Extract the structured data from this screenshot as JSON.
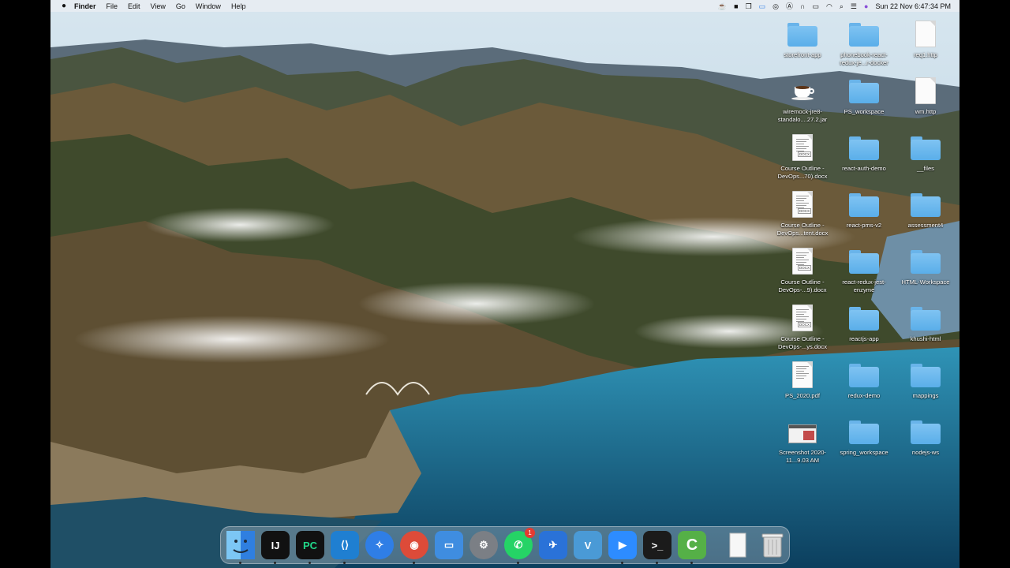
{
  "menubar": {
    "app_name": "Finder",
    "menus": [
      "File",
      "Edit",
      "View",
      "Go",
      "Window",
      "Help"
    ],
    "tray_icons": [
      "coffee-cup-icon",
      "k-icon",
      "copy-icon",
      "window-icon",
      "podcast-icon",
      "a-icon",
      "headphones-icon",
      "battery-icon",
      "wifi-icon",
      "search-icon",
      "control-center-icon",
      "siri-icon"
    ],
    "clock": "Sun 22 Nov  6:47:34 PM"
  },
  "desktop": {
    "items": [
      {
        "label": "storefront-app",
        "type": "folder",
        "col": 0,
        "row": 0
      },
      {
        "label": "phonebook-react-redux-je...r-docker",
        "type": "folder",
        "col": 1,
        "row": 0
      },
      {
        "label": "req1.http",
        "type": "document",
        "col": 2,
        "row": 0
      },
      {
        "label": "wiremock-jre8-standalo....27.2.jar",
        "type": "jar",
        "col": 0,
        "row": 1
      },
      {
        "label": "PS_workspace",
        "type": "folder",
        "col": 1,
        "row": 1
      },
      {
        "label": "wm.http",
        "type": "document",
        "col": 2,
        "row": 1
      },
      {
        "label": "Course Outline - DevOps...70).docx",
        "type": "docx",
        "col": 0,
        "row": 2
      },
      {
        "label": "react-auth-demo",
        "type": "folder",
        "col": 1,
        "row": 2
      },
      {
        "label": "__files",
        "type": "folder",
        "col": 2,
        "row": 2
      },
      {
        "label": "Course Outline - DevOps...tent.docx",
        "type": "docx",
        "col": 0,
        "row": 3
      },
      {
        "label": "react-pms-v2",
        "type": "folder",
        "col": 1,
        "row": 3
      },
      {
        "label": "assessment4",
        "type": "folder",
        "col": 2,
        "row": 3
      },
      {
        "label": "Course Outline - DevOps-...9).docx",
        "type": "docx",
        "col": 0,
        "row": 4
      },
      {
        "label": "react-redux-jest-enzyme",
        "type": "folder",
        "col": 1,
        "row": 4
      },
      {
        "label": "HTML-Workspace",
        "type": "folder",
        "col": 2,
        "row": 4
      },
      {
        "label": "Course Outline - DevOps-...ys.docx",
        "type": "docx",
        "col": 0,
        "row": 5
      },
      {
        "label": "reactjs-app",
        "type": "folder",
        "col": 1,
        "row": 5
      },
      {
        "label": "khushi-html",
        "type": "folder",
        "col": 2,
        "row": 5
      },
      {
        "label": "PS_2020.pdf",
        "type": "pdf",
        "col": 0,
        "row": 6
      },
      {
        "label": "redux-demo",
        "type": "folder",
        "col": 1,
        "row": 6
      },
      {
        "label": "mappings",
        "type": "folder",
        "col": 2,
        "row": 6
      },
      {
        "label": "Screenshot 2020-11...9.03 AM",
        "type": "screenshot",
        "col": 0,
        "row": 7
      },
      {
        "label": "spring_workspace",
        "type": "folder",
        "col": 1,
        "row": 7
      },
      {
        "label": "nodejs-ws",
        "type": "folder",
        "col": 2,
        "row": 7
      }
    ]
  },
  "dock": {
    "apps": [
      {
        "name": "finder-icon",
        "glyph": "",
        "bg": "#3b8fe8",
        "running": true
      },
      {
        "name": "intellij-idea-icon",
        "glyph": "IJ",
        "bg": "#111111",
        "running": true
      },
      {
        "name": "pycharm-icon",
        "glyph": "PC",
        "bg": "#111111",
        "running": true
      },
      {
        "name": "vscode-icon",
        "glyph": "⟨⟩",
        "bg": "#1f7fd1",
        "running": true
      },
      {
        "name": "safari-icon",
        "glyph": "✧",
        "bg": "#2f7ee6",
        "running": false
      },
      {
        "name": "chrome-icon",
        "glyph": "◉",
        "bg": "#dd4b39",
        "running": true
      },
      {
        "name": "keynote-icon",
        "glyph": "▭",
        "bg": "#3f8de0",
        "running": false
      },
      {
        "name": "system-preferences-icon",
        "glyph": "⚙",
        "bg": "#7b7f85",
        "running": false
      },
      {
        "name": "whatsapp-icon",
        "glyph": "✆",
        "bg": "#25d366",
        "running": true,
        "badge": "1"
      },
      {
        "name": "mail-bird-icon",
        "glyph": "✈",
        "bg": "#2a72d8",
        "running": false
      },
      {
        "name": "vmware-icon",
        "glyph": "V",
        "bg": "#4a9ad6",
        "running": false
      },
      {
        "name": "zoom-icon",
        "glyph": "▶",
        "bg": "#2d8cff",
        "running": true
      },
      {
        "name": "terminal-icon",
        "glyph": ">_",
        "bg": "#1b1b1b",
        "running": true
      },
      {
        "name": "camtasia-icon",
        "glyph": "C",
        "bg": "#55b047",
        "running": true
      }
    ],
    "right": [
      {
        "name": "downloads-stack-icon",
        "glyph": "",
        "bg": "#eeeeee"
      },
      {
        "name": "trash-icon",
        "glyph": "",
        "bg": "#dcdcdc"
      }
    ]
  },
  "colors": {
    "folder": "#6fb8ee",
    "sea": "#0f5c7d",
    "sky": "#a9c7de"
  }
}
